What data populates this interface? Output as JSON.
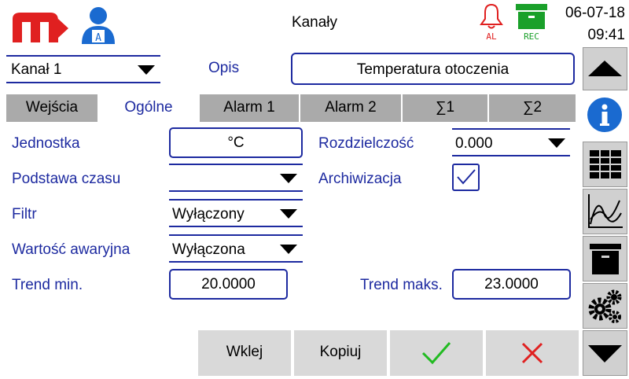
{
  "header": {
    "title": "Kanały",
    "al_label": "AL",
    "rec_label": "REC",
    "date": "06-07-18",
    "time": "09:41"
  },
  "channel": {
    "selected": "Kanał 1",
    "description_label": "Opis",
    "description_value": "Temperatura otoczenia"
  },
  "tabs": [
    {
      "label": "Wejścia",
      "active": false
    },
    {
      "label": "Ogólne",
      "active": true
    },
    {
      "label": "Alarm 1",
      "active": false
    },
    {
      "label": "Alarm 2",
      "active": false
    },
    {
      "label": "∑1",
      "active": false
    },
    {
      "label": "∑2",
      "active": false
    }
  ],
  "form": {
    "unit_label": "Jednostka",
    "unit_value": "°C",
    "resolution_label": "Rozdzielczość",
    "resolution_value": "0.000",
    "timebase_label": "Podstawa czasu",
    "timebase_value": "",
    "archiving_label": "Archiwizacja",
    "archiving_checked": true,
    "filter_label": "Filtr",
    "filter_value": "Wyłączony",
    "fallback_label": "Wartość awaryjna",
    "fallback_value": "Wyłączona",
    "trend_min_label": "Trend min.",
    "trend_min_value": "20.0000",
    "trend_max_label": "Trend maks.",
    "trend_max_value": "23.0000"
  },
  "buttons": {
    "paste": "Wklej",
    "copy": "Kopiuj"
  },
  "colors": {
    "accent": "#1d2aa0",
    "logo_red": "#e02020",
    "user_blue": "#1a6ad0",
    "rec_green": "#1aa02a",
    "ok_green": "#22bb22",
    "cancel_red": "#e02020"
  }
}
